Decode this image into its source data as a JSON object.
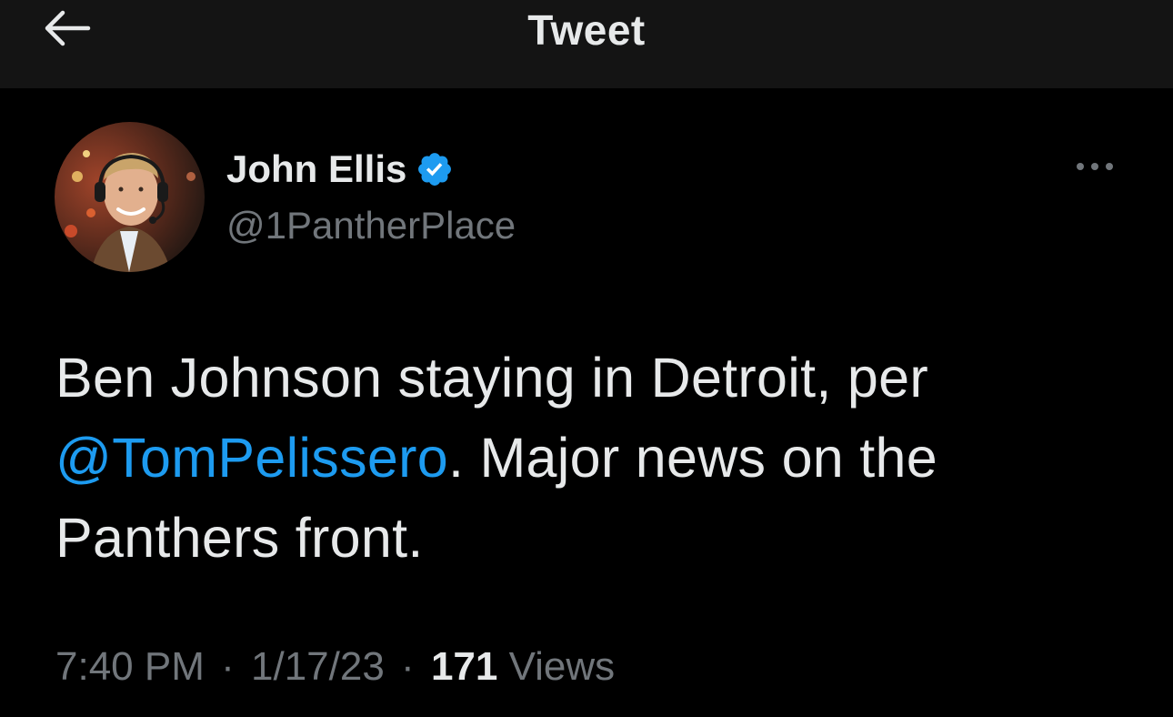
{
  "header": {
    "title": "Tweet",
    "back_icon": "arrow-left-icon"
  },
  "author": {
    "display_name": "John Ellis",
    "handle": "@1PantherPlace",
    "verified": true,
    "verified_icon": "verified-badge-icon",
    "verified_color": "#1d9bf0"
  },
  "tweet": {
    "text_before": "Ben Johnson staying in Detroit, per ",
    "mention": "@TomPelissero",
    "text_after": ". Major news on the Panthers front.",
    "time": "7:40 PM",
    "date": "1/17/23",
    "separator": "·",
    "views_count": "171",
    "views_label": "Views"
  },
  "actions": {
    "more_icon": "more-options-icon"
  },
  "colors": {
    "background": "#000000",
    "header_background": "#141414",
    "text_primary": "#e7e9ea",
    "text_secondary": "#71767b",
    "link": "#1d9bf0"
  }
}
